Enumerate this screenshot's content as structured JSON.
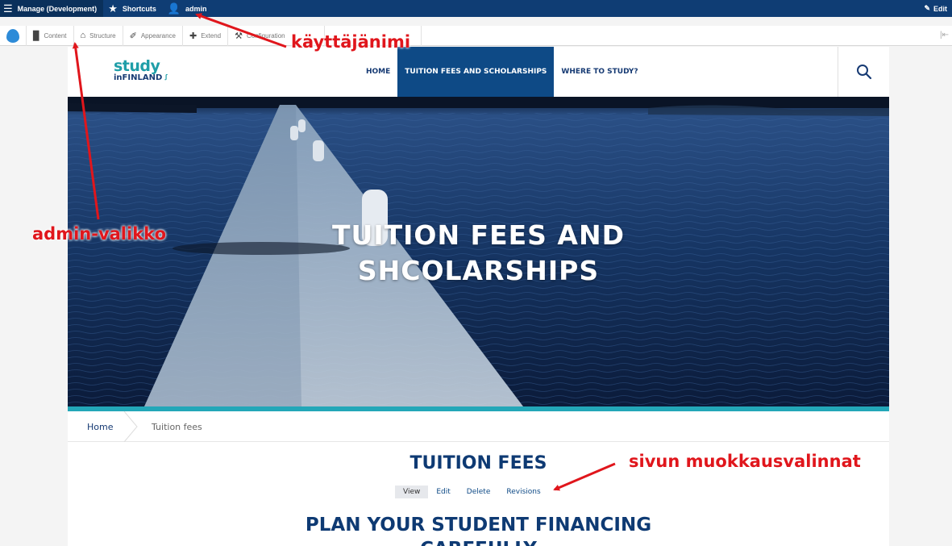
{
  "toolbar": {
    "manage_label": "Manage (Development)",
    "shortcuts_label": "Shortcuts",
    "user_label": "admin",
    "edit_label": "Edit",
    "tray": [
      {
        "label": "Content",
        "icon": "file-icon"
      },
      {
        "label": "Structure",
        "icon": "sitemap-icon"
      },
      {
        "label": "Appearance",
        "icon": "paintbrush-icon"
      },
      {
        "label": "Extend",
        "icon": "puzzle-icon"
      },
      {
        "label": "Configuration",
        "icon": "wrench-icon"
      }
    ]
  },
  "site": {
    "logo_line1": "study",
    "logo_line2": "inFINLAND",
    "nav": [
      {
        "label": "HOME",
        "active": false
      },
      {
        "label": "TUITION FEES AND SCHOLARSHIPS",
        "active": true
      },
      {
        "label": "WHERE TO STUDY?",
        "active": false
      }
    ],
    "search_icon": "search-icon"
  },
  "hero": {
    "title_line1": "TUITION FEES AND",
    "title_line2": "SHCOLARSHIPS"
  },
  "breadcrumb": {
    "home": "Home",
    "current": "Tuition fees"
  },
  "content": {
    "page_title": "TUITION FEES",
    "tabs": [
      {
        "label": "View",
        "active": true
      },
      {
        "label": "Edit",
        "active": false
      },
      {
        "label": "Delete",
        "active": false
      },
      {
        "label": "Revisions",
        "active": false
      }
    ],
    "plan_title_line1": "PLAN YOUR STUDENT FINANCING",
    "plan_title_line2": "CAREFULLY"
  },
  "annotations": {
    "username": "käyttäjänimi",
    "admin_menu": "admin-valikko",
    "page_edit_options": "sivun muokkausvalinnat"
  },
  "colors": {
    "toolbar_bg": "#0f3d74",
    "nav_active": "#0e4a86",
    "accent_teal": "#23a7b8",
    "annotation_red": "#e0161c"
  }
}
